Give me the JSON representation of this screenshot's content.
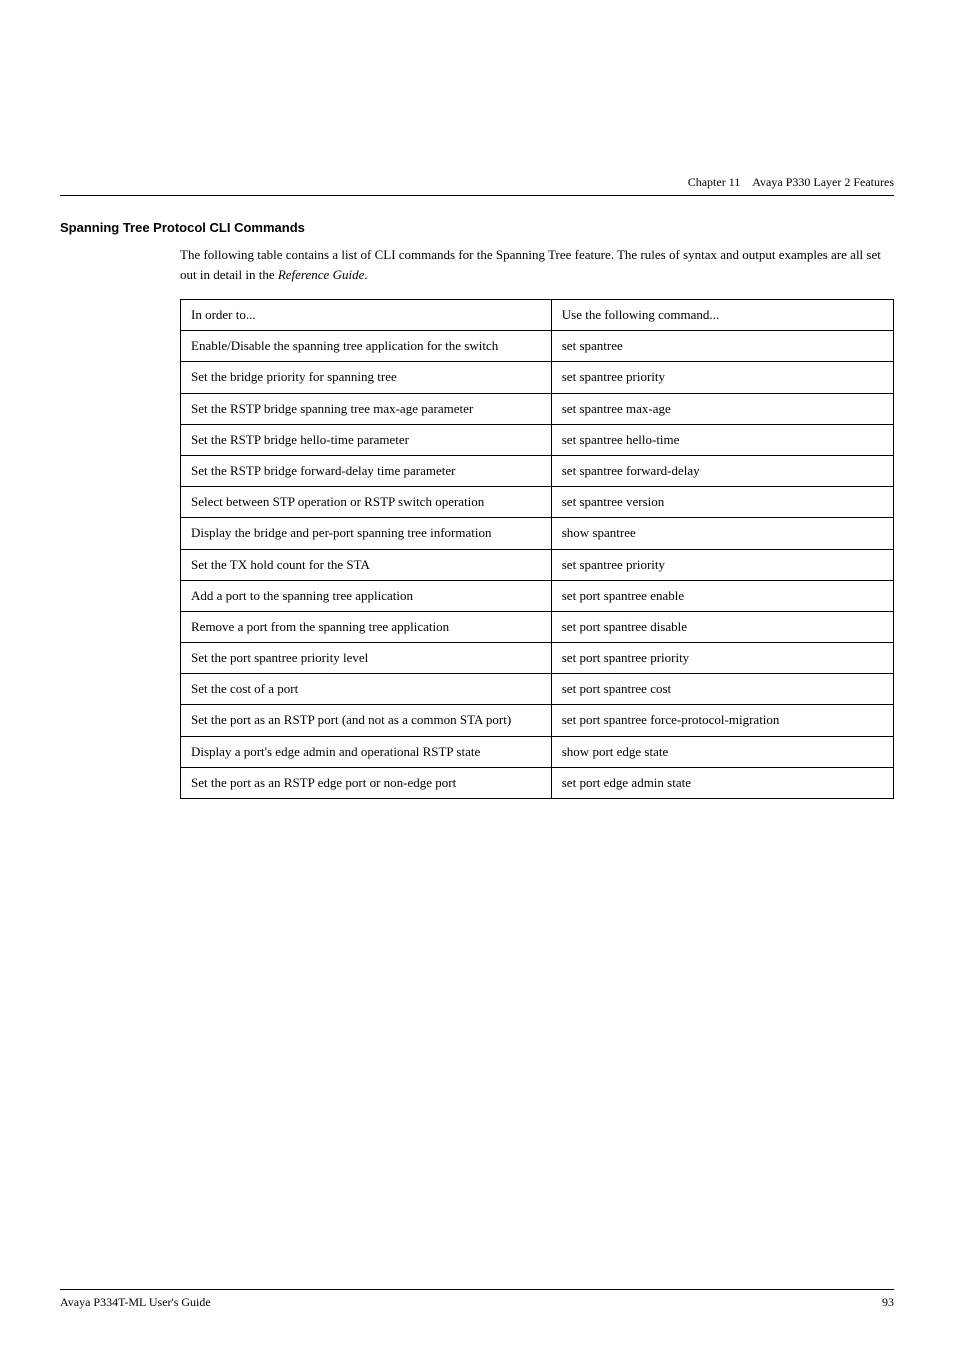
{
  "header": {
    "chapter": "Chapter 11",
    "title": "Avaya P330 Layer 2 Features"
  },
  "section": {
    "title": "Spanning Tree Protocol CLI Commands",
    "intro": "The following table contains a list of CLI commands for the Spanning Tree feature. The rules of syntax and output examples are all set out in detail in the ",
    "intro_italic": "Reference Guide",
    "intro_end": "."
  },
  "table": {
    "col1_header": "In order to...",
    "col2_header": "Use the following command...",
    "rows": [
      {
        "col1": "Enable/Disable the spanning tree application for the switch",
        "col2": "set spantree"
      },
      {
        "col1": "Set the bridge priority for spanning tree",
        "col2": "set spantree priority"
      },
      {
        "col1": "Set the RSTP bridge spanning tree max-age parameter",
        "col2": "set spantree max-age"
      },
      {
        "col1": "Set the RSTP bridge hello-time parameter",
        "col2": "set spantree hello-time"
      },
      {
        "col1": "Set the RSTP bridge forward-delay time parameter",
        "col2": "set spantree forward-delay"
      },
      {
        "col1": "Select between STP operation or RSTP switch operation",
        "col2": "set spantree version"
      },
      {
        "col1": "Display the bridge and per-port spanning tree information",
        "col2": "show spantree"
      },
      {
        "col1": "Set the TX hold count for the STA",
        "col2": "set spantree priority"
      },
      {
        "col1": "Add a port to the spanning tree application",
        "col2": "set port spantree enable"
      },
      {
        "col1": "Remove a port from the spanning tree application",
        "col2": "set port spantree disable"
      },
      {
        "col1": "Set the port spantree priority level",
        "col2": "set port spantree priority"
      },
      {
        "col1": "Set the cost of a port",
        "col2": "set port spantree cost"
      },
      {
        "col1": "Set the port as an RSTP port (and not as a common STA port)",
        "col2": "set port spantree force-protocol-migration"
      },
      {
        "col1": "Display a port's edge admin and operational RSTP state",
        "col2": "show port edge state"
      },
      {
        "col1": "Set the port as an RSTP edge port or non-edge port",
        "col2": "set port edge admin state"
      }
    ]
  },
  "footer": {
    "left": "Avaya P334T-ML User's Guide",
    "right": "93"
  }
}
